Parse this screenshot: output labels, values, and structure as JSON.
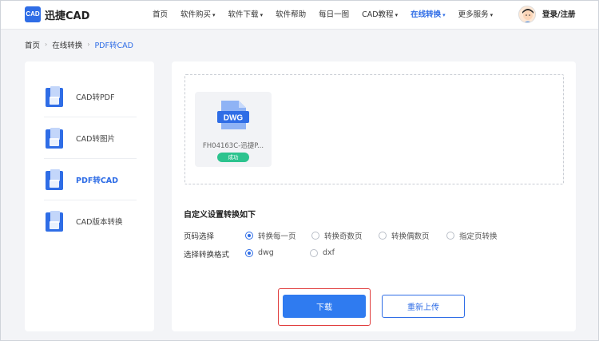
{
  "brand": {
    "logo_text": "CAD",
    "name": "迅捷CAD"
  },
  "nav": [
    {
      "label": "首页",
      "caret": false,
      "active": false
    },
    {
      "label": "软件购买",
      "caret": true,
      "active": false
    },
    {
      "label": "软件下载",
      "caret": true,
      "active": false
    },
    {
      "label": "软件帮助",
      "caret": false,
      "active": false
    },
    {
      "label": "每日一图",
      "caret": false,
      "active": false
    },
    {
      "label": "CAD教程",
      "caret": true,
      "active": false
    },
    {
      "label": "在线转换",
      "caret": true,
      "active": true
    },
    {
      "label": "更多服务",
      "caret": true,
      "active": false
    }
  ],
  "user": {
    "login_label": "登录/注册"
  },
  "breadcrumb": {
    "home": "首页",
    "section": "在线转换",
    "current": "PDF转CAD"
  },
  "sidebar": {
    "items": [
      {
        "label": "CAD转PDF",
        "active": false
      },
      {
        "label": "CAD转图片",
        "active": false
      },
      {
        "label": "PDF转CAD",
        "active": true
      },
      {
        "label": "CAD版本转换",
        "active": false
      }
    ]
  },
  "file": {
    "type_label": "DWG",
    "name": "FH04163C-迅捷P...",
    "status": "成功"
  },
  "settings": {
    "title": "自定义设置转换如下",
    "page_label": "页码选择",
    "page_options": [
      "转换每一页",
      "转换奇数页",
      "转换偶数页",
      "指定页转换"
    ],
    "page_selected": 0,
    "format_label": "选择转换格式",
    "format_options": [
      "dwg",
      "dxf"
    ],
    "format_selected": 0
  },
  "actions": {
    "download_label": "下载",
    "reupload_label": "重新上传"
  },
  "colors": {
    "accent": "#2f6de6",
    "success": "#2cc38e",
    "highlight": "#e03c3c"
  }
}
